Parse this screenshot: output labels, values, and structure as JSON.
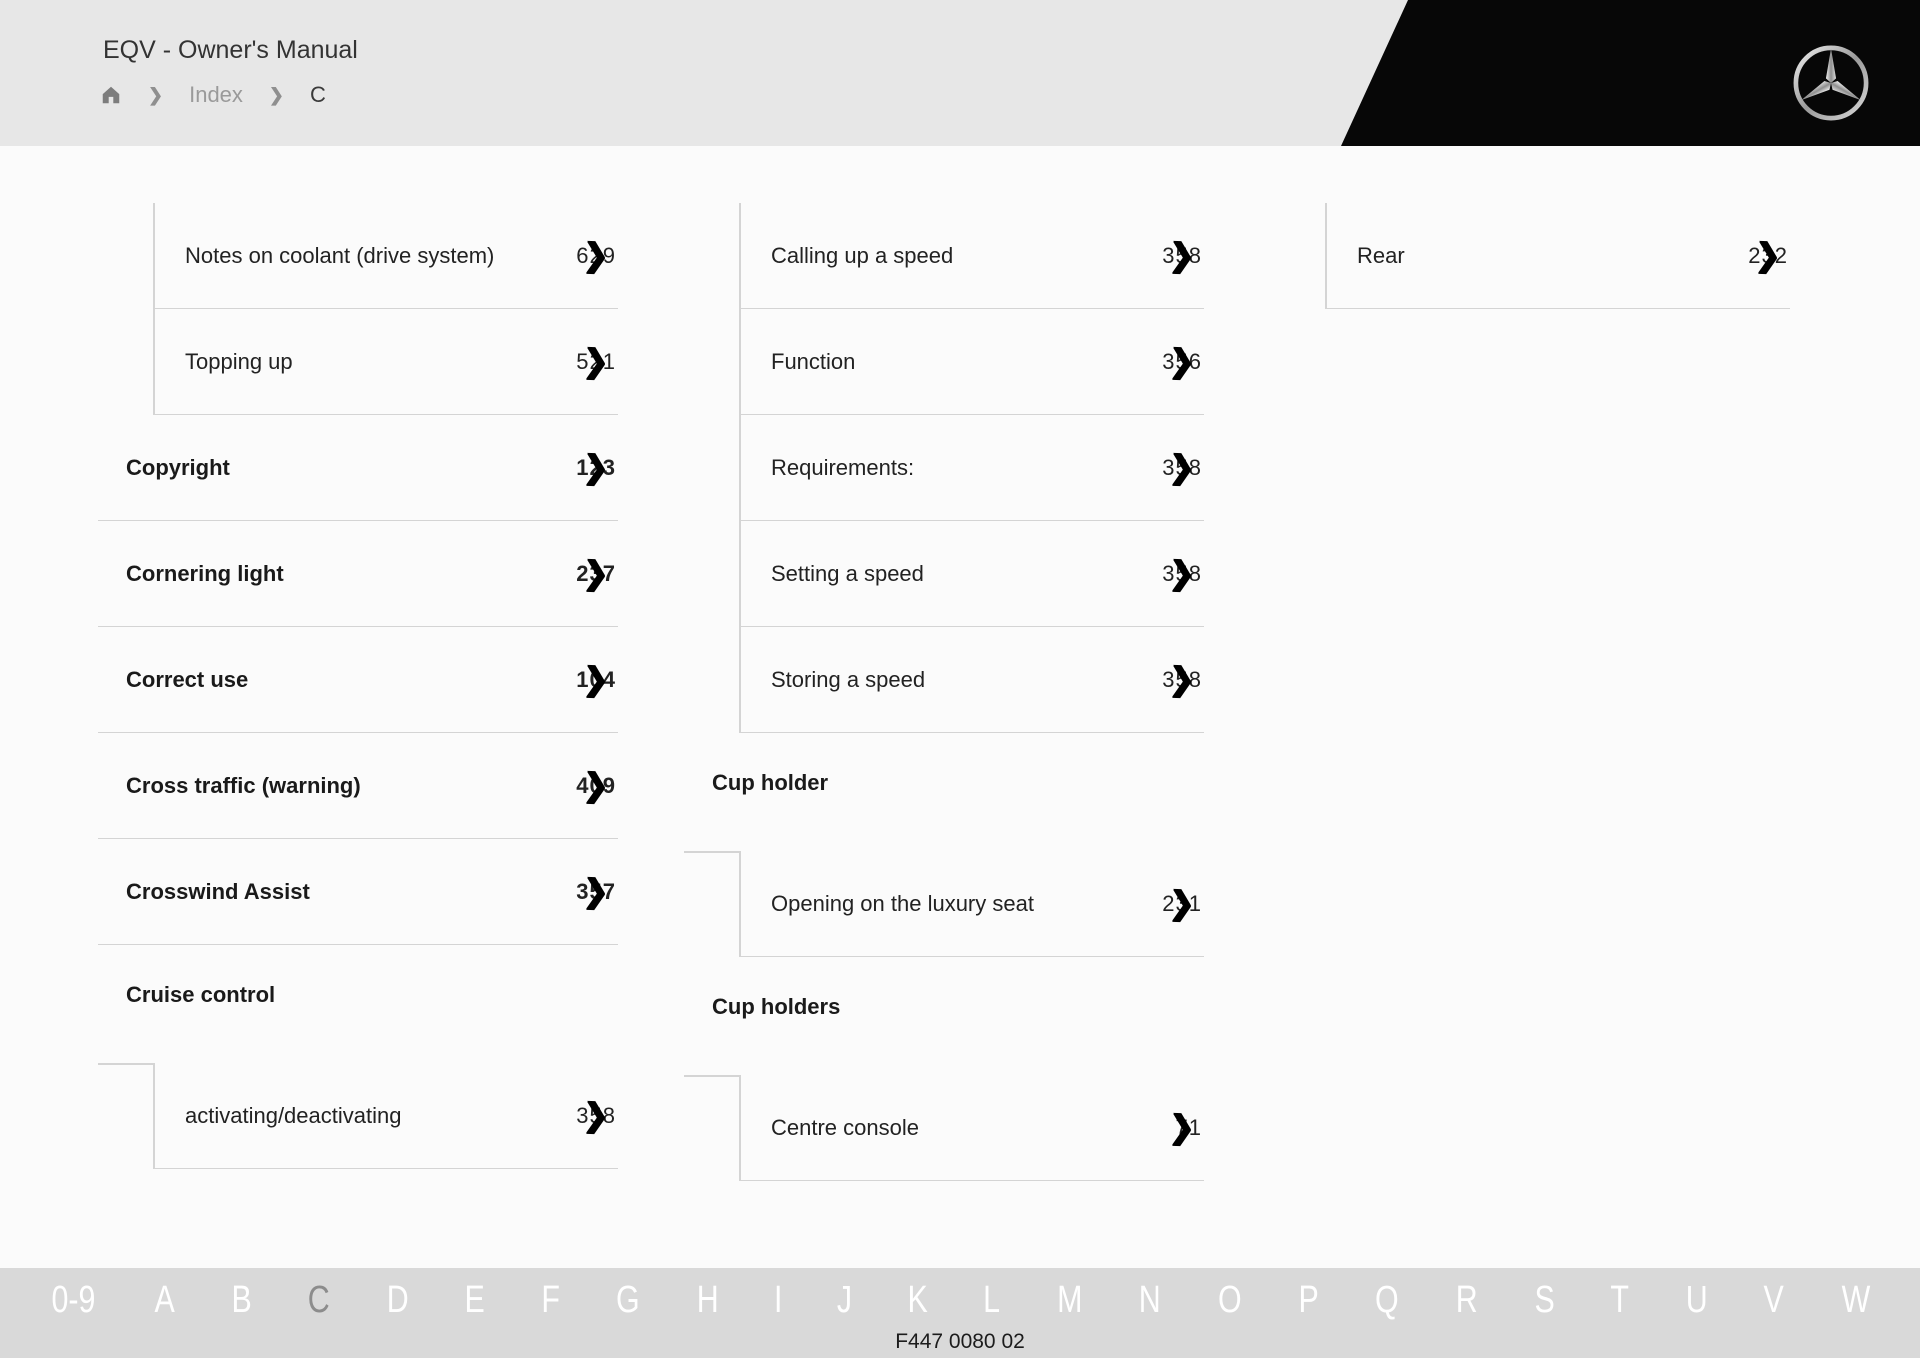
{
  "app": {
    "title": "EQV - Owner's Manual"
  },
  "breadcrumb": {
    "items": [
      {
        "label": "Index"
      },
      {
        "label": "C"
      }
    ]
  },
  "index_columns": [
    {
      "blocks": [
        {
          "type": "group",
          "connector": false,
          "items": [
            {
              "label": "Notes on coolant (drive system)",
              "page": "629"
            },
            {
              "label": "Topping up",
              "page": "521"
            }
          ]
        },
        {
          "type": "entry",
          "label": "Copyright",
          "page": "123"
        },
        {
          "type": "entry",
          "label": "Cornering light",
          "page": "237"
        },
        {
          "type": "entry",
          "label": "Correct use",
          "page": "104"
        },
        {
          "type": "entry",
          "label": "Cross traffic (warning)",
          "page": "409"
        },
        {
          "type": "entry",
          "label": "Crosswind Assist",
          "page": "357"
        },
        {
          "type": "heading",
          "label": "Cruise control"
        },
        {
          "type": "group",
          "connector": true,
          "items": [
            {
              "label": "activating/deactivating",
              "page": "358"
            }
          ]
        }
      ]
    },
    {
      "blocks": [
        {
          "type": "group",
          "connector": false,
          "items": [
            {
              "label": "Calling up a speed",
              "page": "358"
            },
            {
              "label": "Function",
              "page": "356"
            },
            {
              "label": "Requirements:",
              "page": "358"
            },
            {
              "label": "Setting a speed",
              "page": "358"
            },
            {
              "label": "Storing a speed",
              "page": "358"
            }
          ]
        },
        {
          "type": "heading",
          "label": "Cup holder"
        },
        {
          "type": "group",
          "connector": true,
          "items": [
            {
              "label": "Opening on the luxury seat",
              "page": "231"
            }
          ]
        },
        {
          "type": "heading",
          "label": "Cup holders"
        },
        {
          "type": "group",
          "connector": true,
          "items": [
            {
              "label": "Centre console",
              "page": "71"
            }
          ]
        }
      ]
    },
    {
      "blocks": [
        {
          "type": "group",
          "connector": false,
          "items": [
            {
              "label": "Rear",
              "page": "232"
            }
          ]
        }
      ]
    }
  ],
  "alphabet_bar": {
    "letters": [
      "0-9",
      "A",
      "B",
      "C",
      "D",
      "E",
      "F",
      "G",
      "H",
      "I",
      "J",
      "K",
      "L",
      "M",
      "N",
      "O",
      "P",
      "Q",
      "R",
      "S",
      "T",
      "U",
      "V",
      "W"
    ],
    "active": "C"
  },
  "footer": {
    "code": "F447 0080 02"
  },
  "icons": {
    "jump_arrow": "❯",
    "crumb_chevron": "❯"
  },
  "colors": {
    "header_bg": "#e7e7e7",
    "wedge": "#070707",
    "main_bg": "#fbfbfb",
    "bar_bg": "#d9d9d9",
    "separator": "#d4d4d4",
    "logo_silver": "#c9c9c9"
  }
}
